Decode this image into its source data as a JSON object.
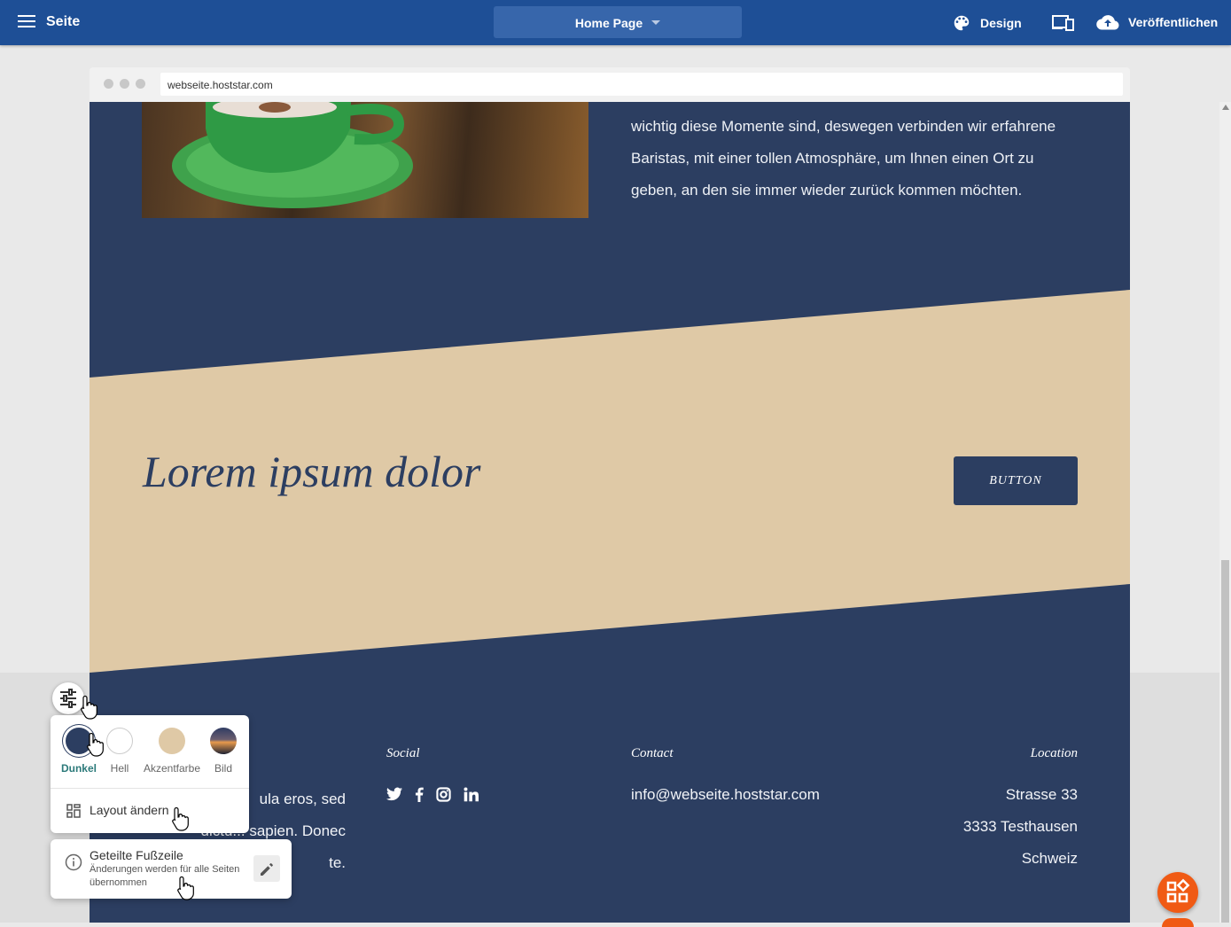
{
  "topbar": {
    "title": "Seite",
    "page_select": "Home Page",
    "design_label": "Design",
    "publish_label": "Veröffentlichen"
  },
  "browser": {
    "url": "webseite.hoststar.com"
  },
  "site": {
    "intro_lines": [
      "wichtig diese Momente sind, deswegen verbinden wir erfahrene",
      "Baristas, mit einer tollen Atmosphäre, um Ihnen einen Ort zu",
      "geben, an den sie immer wieder zurück kommen möchten."
    ],
    "banner_title": "Lorem ipsum dolor",
    "banner_button": "BUTTON",
    "footer": {
      "social_heading": "Social",
      "contact_heading": "Contact",
      "location_heading": "Location",
      "about_lines": [
        "ula eros, sed",
        "dictu... sapien. Donec",
        "te."
      ],
      "email": "info@webseite.hoststar.com",
      "address_lines": [
        "Strasse 33",
        "3333 Testhausen",
        "Schweiz"
      ],
      "social_icons": [
        "twitter-icon",
        "facebook-icon",
        "instagram-icon",
        "linkedin-icon"
      ]
    }
  },
  "style_popup": {
    "options": [
      {
        "label": "Dunkel",
        "color": "#2c3e61",
        "selected": true
      },
      {
        "label": "Hell",
        "color": "#ffffff",
        "selected": false
      },
      {
        "label": "Akzentfarbe",
        "color": "#dfc9a6",
        "selected": false
      },
      {
        "label": "Bild",
        "color": "image",
        "selected": false
      }
    ],
    "layout_label": "Layout ändern"
  },
  "shared_footer_popup": {
    "title": "Geteilte Fußzeile",
    "subtitle": "Änderungen werden für alle Seiten übernommen"
  },
  "colors": {
    "topbar": "#1e4f96",
    "navy": "#2c3e61",
    "accent": "#dfc9a6",
    "fab": "#f05a14"
  }
}
